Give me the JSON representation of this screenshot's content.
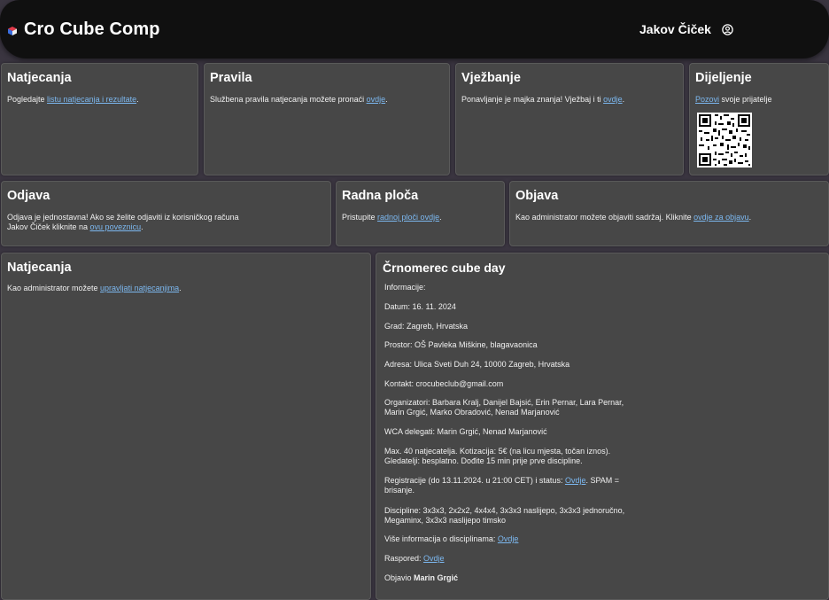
{
  "header": {
    "logo_text": "Cro Cube Comp",
    "user_name": "Jakov Čiček"
  },
  "cards": {
    "natjecanja": {
      "title": "Natjecanja",
      "text_before": "Pogledajte ",
      "link": "listu natjecanja i rezultate",
      "text_after": "."
    },
    "pravila": {
      "title": "Pravila",
      "text_before": "Službena pravila natjecanja možete pronaći ",
      "link": "ovdje",
      "text_after": "."
    },
    "vjezbanje": {
      "title": "Vježbanje",
      "text_before": "Ponavljanje je majka znanja! Vježbaj i ti ",
      "link": "ovdje",
      "text_after": "."
    },
    "dijeljenje": {
      "title": "Dijeljenje",
      "link": "Pozovi",
      "text_after": " svoje prijatelje"
    },
    "odjava": {
      "title": "Odjava",
      "line1": "Odjava je jednostavna! Ako se želite odjaviti iz korisničkog računa",
      "line2_before": "Jakov Čiček kliknite na ",
      "link": "ovu poveznicu",
      "text_after": "."
    },
    "radna_ploca": {
      "title": "Radna ploča",
      "text_before": "Pristupite ",
      "link": "radnoj ploči ovdje",
      "text_after": "."
    },
    "objava": {
      "title": "Objava",
      "text_before": "Kao administrator možete objaviti sadržaj. Kliknite ",
      "link": "ovdje za objavu",
      "text_after": "."
    },
    "natjecanja_admin": {
      "title": "Natjecanja",
      "text_before": "Kao administrator možete ",
      "link": "upravljati natjecanjima",
      "text_after": "."
    }
  },
  "post": {
    "title": "Črnomerec cube day",
    "informacije": "Informacije:",
    "datum": "Datum: 16. 11. 2024",
    "grad": "Grad: Zagreb, Hrvatska",
    "prostor": "Prostor: OŠ Pavleka Miškine, blagavaonica",
    "adresa": "Adresa: Ulica Sveti Duh 24, 10000 Zagreb, Hrvatska",
    "kontakt": "Kontakt: crocubeclub@gmail.com",
    "organizatori_1": "Organizatori: Barbara Kralj, Danijel Bajsić, Erin Pernar, Lara Pernar,",
    "organizatori_2": "Marin Grgić, Marko Obradović, Nenad Marjanović",
    "wca": "WCA delegati: Marin Grgić, Nenad Marjanović",
    "max_1": "Max. 40 natjecatelja. Kotizacija: 5€ (na licu mjesta, točan iznos).",
    "max_2": "Gledatelji: besplatno. Dođite 15 min prije prve discipline.",
    "reg_before": "Registracije (do 13.11.2024. u 21:00 CET) i status: ",
    "reg_link": "Ovdje",
    "reg_after": ". SPAM =",
    "reg_2": "brisanje.",
    "disc_1": "Discipline: 3x3x3, 2x2x2, 4x4x4, 3x3x3 naslijepo, 3x3x3 jednoručno,",
    "disc_2": "Megaminx, 3x3x3 naslijepo timsko",
    "vise_before": "Više informacija o disciplinama: ",
    "vise_link": "Ovdje",
    "raspored_before": "Raspored: ",
    "raspored_link": "Ovdje",
    "objavio_before": "Objavio ",
    "objavio_name": "Marin Grgić"
  },
  "colors": {
    "link": "#7cb8f0",
    "card_bg": "#474747",
    "header_bg": "#101010",
    "page_bg": "#3a3540"
  }
}
